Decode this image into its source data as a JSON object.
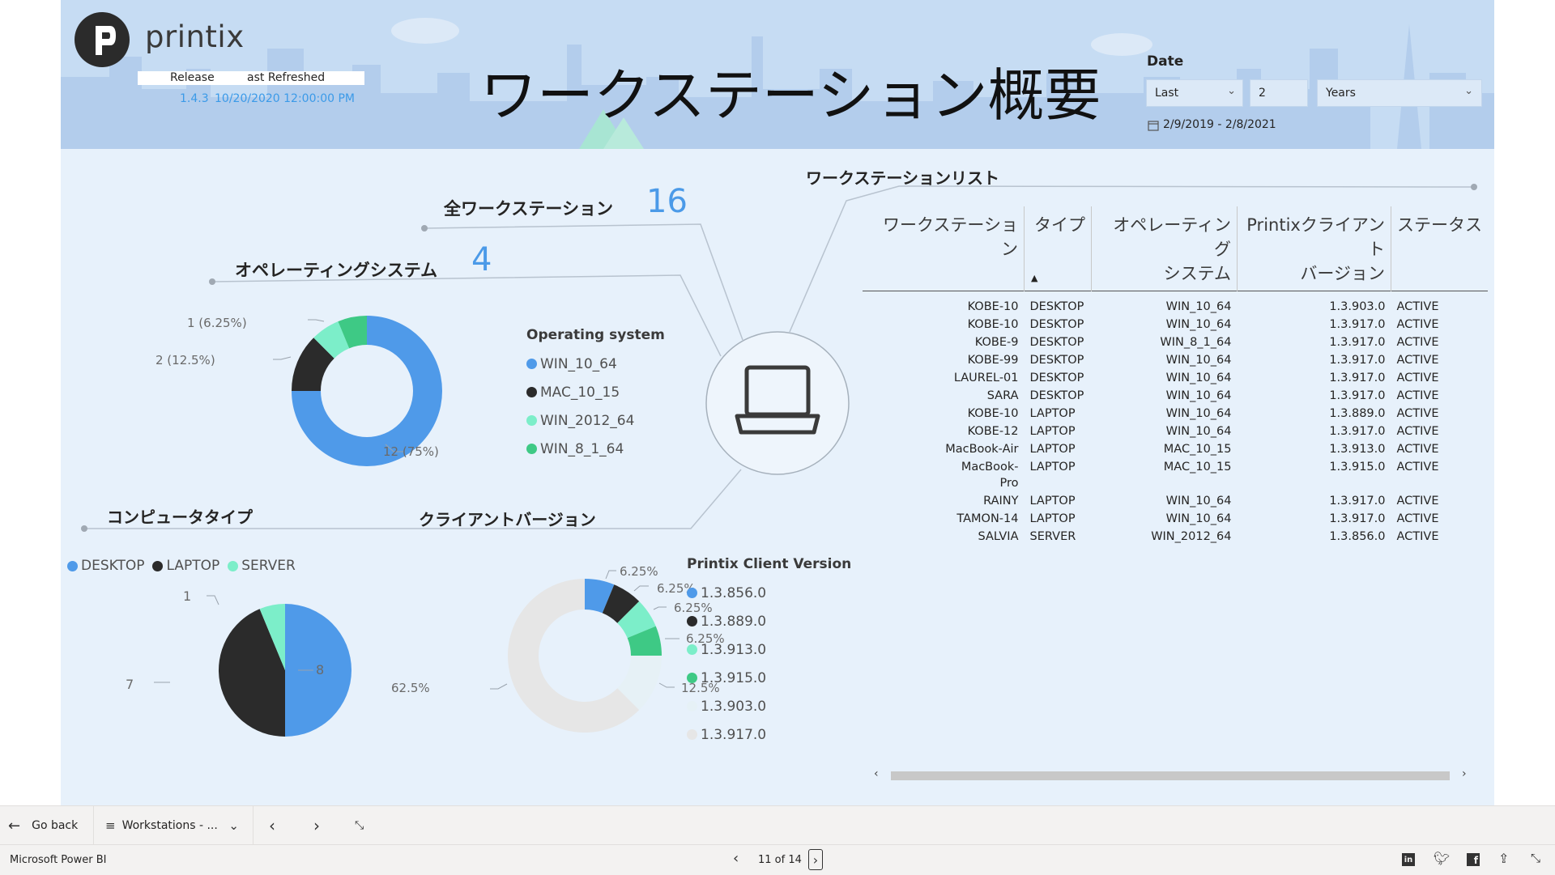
{
  "header": {
    "logo_text": "printix",
    "release_label": "Release",
    "refreshed_label": "ast Refreshed",
    "release_value": "1.4.3",
    "refreshed_value": "10/20/2020 12:00:00 PM",
    "title": "ワークステーション概要"
  },
  "date_slicer": {
    "title": "Date",
    "mode": "Last",
    "count": "2",
    "unit": "Years",
    "range": "2/9/2019 - 2/8/2021"
  },
  "kpis": {
    "all_workstations_label": "全ワークステーション",
    "all_workstations_value": "16",
    "os_label": "オペレーティングシステム",
    "os_value": "4"
  },
  "sections": {
    "computer_type": "コンピュータタイプ",
    "client_version": "クライアントバージョン",
    "workstation_list": "ワークステーションリスト"
  },
  "colors": {
    "blue": "#4f9ae9",
    "black": "#2b2b2b",
    "mint": "#7ceec9",
    "green": "#3ec985",
    "verylight": "#e6f1f6",
    "lightgray": "#e6e6e6"
  },
  "os_chart": {
    "legend_title": "Operating system",
    "legend": [
      {
        "name": "WIN_10_64",
        "color": "#4f9ae9"
      },
      {
        "name": "MAC_10_15",
        "color": "#2b2b2b"
      },
      {
        "name": "WIN_2012_64",
        "color": "#7ceec9"
      },
      {
        "name": "WIN_8_1_64",
        "color": "#3ec985"
      }
    ],
    "labels": {
      "win10": "12 (75%)",
      "mac": "2 (12.5%)",
      "win2012": "1 (6.25%)"
    }
  },
  "type_chart": {
    "legend": [
      {
        "name": "DESKTOP",
        "color": "#4f9ae9"
      },
      {
        "name": "LAPTOP",
        "color": "#2b2b2b"
      },
      {
        "name": "SERVER",
        "color": "#7ceec9"
      }
    ],
    "labels": {
      "desktop": "8",
      "laptop": "7",
      "server": "1"
    }
  },
  "version_chart": {
    "legend_title": "Printix Client Version",
    "legend": [
      {
        "name": "1.3.856.0",
        "color": "#4f9ae9"
      },
      {
        "name": "1.3.889.0",
        "color": "#2b2b2b"
      },
      {
        "name": "1.3.913.0",
        "color": "#7ceec9"
      },
      {
        "name": "1.3.915.0",
        "color": "#3ec985"
      },
      {
        "name": "1.3.903.0",
        "color": "#e6f1f6"
      },
      {
        "name": "1.3.917.0",
        "color": "#e6e6e6"
      }
    ],
    "labels": {
      "v856": "6.25%",
      "v889": "6.25%",
      "v913": "6.25%",
      "v915": "6.25%",
      "v903": "12.5%",
      "v917": "62.5%"
    }
  },
  "chart_data": [
    {
      "type": "pie",
      "categories": [
        "WIN_10_64",
        "MAC_10_15",
        "WIN_2012_64",
        "WIN_8_1_64"
      ],
      "values": [
        12,
        2,
        1,
        1
      ],
      "title": "",
      "legend_title": "Operating system",
      "donut": true
    },
    {
      "type": "pie",
      "categories": [
        "DESKTOP",
        "LAPTOP",
        "SERVER"
      ],
      "values": [
        8,
        7,
        1
      ],
      "title": ""
    },
    {
      "type": "pie",
      "categories": [
        "1.3.856.0",
        "1.3.889.0",
        "1.3.913.0",
        "1.3.915.0",
        "1.3.903.0",
        "1.3.917.0"
      ],
      "values": [
        6.25,
        6.25,
        6.25,
        6.25,
        12.5,
        62.5
      ],
      "title": "",
      "legend_title": "Printix Client Version",
      "donut": true
    }
  ],
  "table": {
    "headers": {
      "workstation": "ワークステーション",
      "type": "タイプ",
      "os_line1": "オペレーティング",
      "os_line2": "システム",
      "version_line1": "Printixクライアント",
      "version_line2": "バージョン",
      "status": "ステータス"
    },
    "rows": [
      {
        "name": "KOBE-10",
        "type": "DESKTOP",
        "os": "WIN_10_64",
        "version": "1.3.903.0",
        "status": "ACTIVE"
      },
      {
        "name": "KOBE-10",
        "type": "DESKTOP",
        "os": "WIN_10_64",
        "version": "1.3.917.0",
        "status": "ACTIVE"
      },
      {
        "name": "KOBE-9",
        "type": "DESKTOP",
        "os": "WIN_8_1_64",
        "version": "1.3.917.0",
        "status": "ACTIVE"
      },
      {
        "name": "KOBE-99",
        "type": "DESKTOP",
        "os": "WIN_10_64",
        "version": "1.3.917.0",
        "status": "ACTIVE"
      },
      {
        "name": "LAUREL-01",
        "type": "DESKTOP",
        "os": "WIN_10_64",
        "version": "1.3.917.0",
        "status": "ACTIVE"
      },
      {
        "name": "SARA",
        "type": "DESKTOP",
        "os": "WIN_10_64",
        "version": "1.3.917.0",
        "status": "ACTIVE"
      },
      {
        "name": "KOBE-10",
        "type": "LAPTOP",
        "os": "WIN_10_64",
        "version": "1.3.889.0",
        "status": "ACTIVE"
      },
      {
        "name": "KOBE-12",
        "type": "LAPTOP",
        "os": "WIN_10_64",
        "version": "1.3.917.0",
        "status": "ACTIVE"
      },
      {
        "name": "MacBook-Air",
        "type": "LAPTOP",
        "os": "MAC_10_15",
        "version": "1.3.913.0",
        "status": "ACTIVE"
      },
      {
        "name": "MacBook-Pro",
        "type": "LAPTOP",
        "os": "MAC_10_15",
        "version": "1.3.915.0",
        "status": "ACTIVE"
      },
      {
        "name": "RAINY",
        "type": "LAPTOP",
        "os": "WIN_10_64",
        "version": "1.3.917.0",
        "status": "ACTIVE"
      },
      {
        "name": "TAMON-14",
        "type": "LAPTOP",
        "os": "WIN_10_64",
        "version": "1.3.917.0",
        "status": "ACTIVE"
      },
      {
        "name": "SALVIA",
        "type": "SERVER",
        "os": "WIN_2012_64",
        "version": "1.3.856.0",
        "status": "ACTIVE"
      }
    ]
  },
  "bottom_bar": {
    "go_back": "Go back",
    "page_select": "Workstations - ..."
  },
  "status_bar": {
    "app_name": "Microsoft Power BI",
    "page_indicator": "11 of 14"
  }
}
